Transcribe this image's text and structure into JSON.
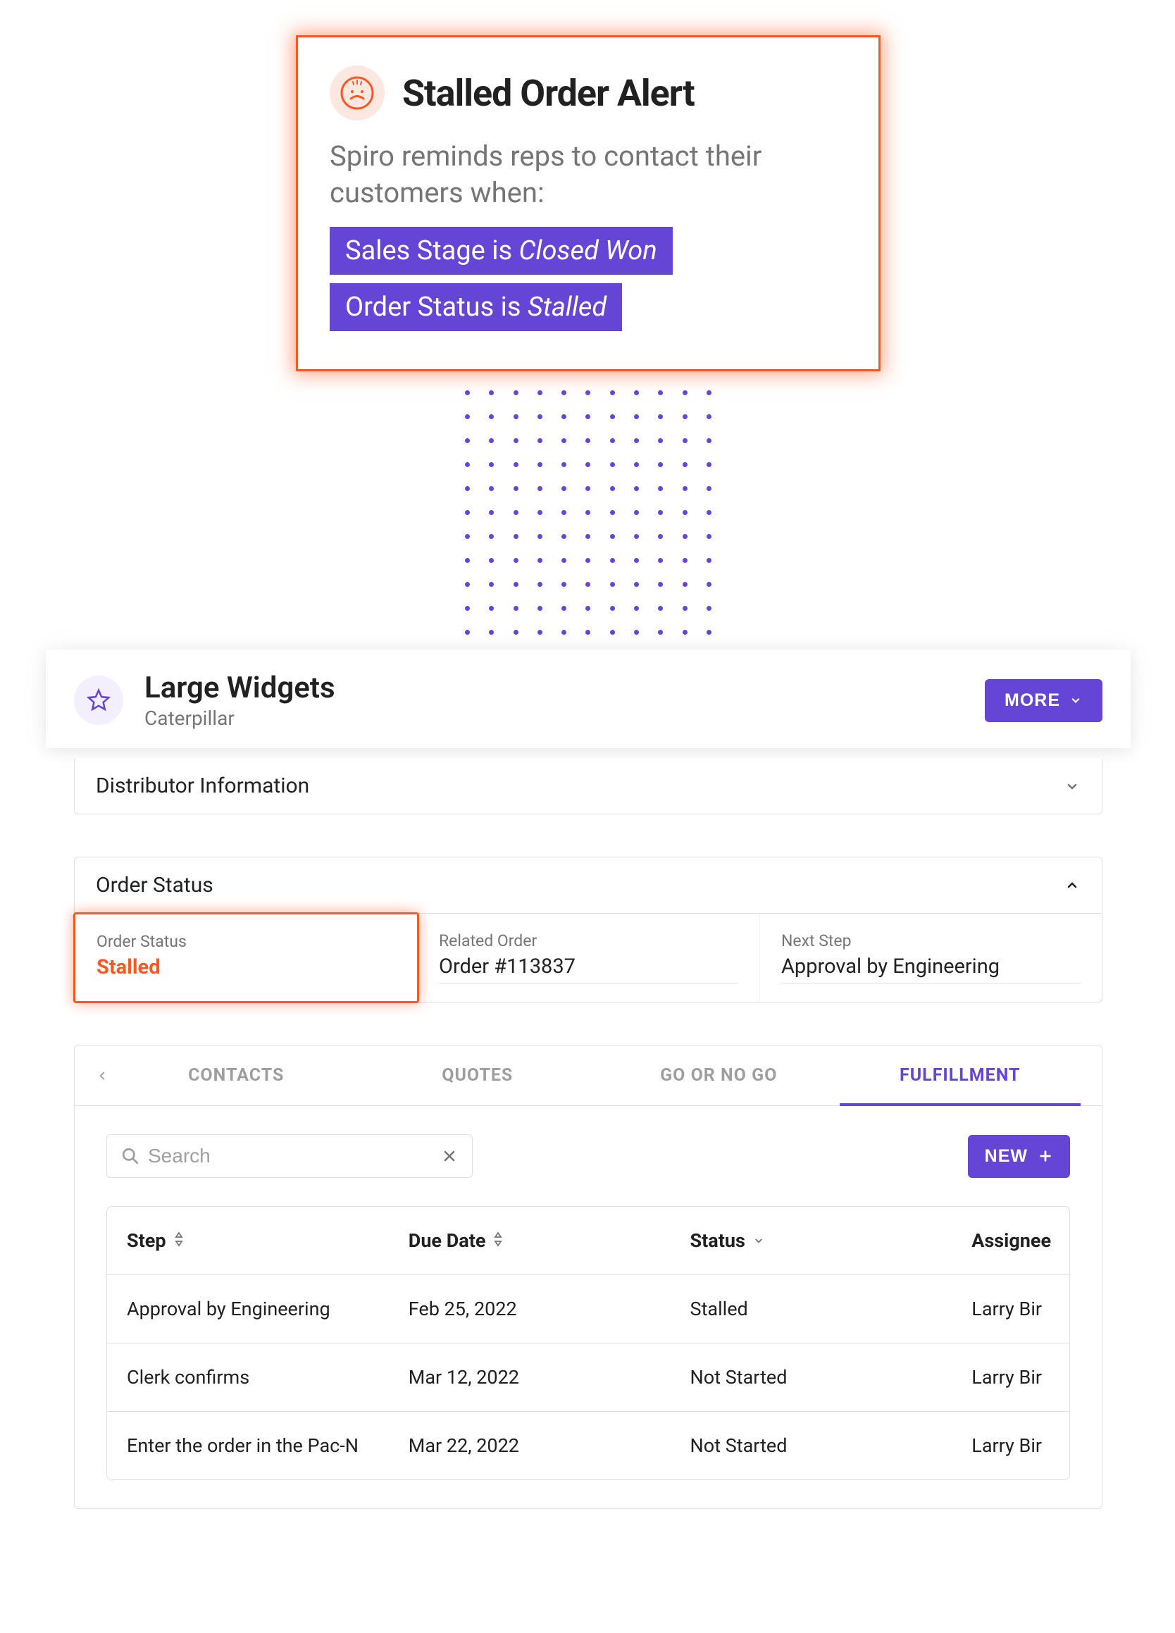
{
  "alert": {
    "title": "Stalled Order Alert",
    "description": "Spiro reminds reps to contact their customers when:",
    "conditions": [
      {
        "field": "Sales Stage is ",
        "value": "Closed Won"
      },
      {
        "field": "Order Status is ",
        "value": "Stalled"
      }
    ]
  },
  "record": {
    "title": "Large Widgets",
    "subtitle": "Caterpillar",
    "more_label": "MORE"
  },
  "sections": {
    "distributor": {
      "title": "Distributor Information"
    },
    "order_status": {
      "title": "Order Status",
      "fields": [
        {
          "label": "Order Status",
          "value": "Stalled",
          "highlighted": true
        },
        {
          "label": "Related Order",
          "value": "Order #113837"
        },
        {
          "label": "Next Step",
          "value": "Approval by Engineering"
        }
      ]
    }
  },
  "tabs": {
    "items": [
      "CONTACTS",
      "QUOTES",
      "GO OR NO GO",
      "FULFILLMENT"
    ],
    "active_index": 3,
    "search_placeholder": "Search",
    "new_label": "NEW",
    "columns": [
      "Step",
      "Due Date",
      "Status",
      "Assignee"
    ],
    "rows": [
      {
        "step": "Approval by Engineering",
        "due": "Feb 25, 2022",
        "status": "Stalled",
        "assignee": "Larry Bir"
      },
      {
        "step": "Clerk confirms",
        "due": "Mar 12, 2022",
        "status": "Not Started",
        "assignee": "Larry Bir"
      },
      {
        "step": "Enter the order in the Pac-N",
        "due": "Mar 22, 2022",
        "status": "Not Started",
        "assignee": "Larry Bir"
      }
    ]
  }
}
